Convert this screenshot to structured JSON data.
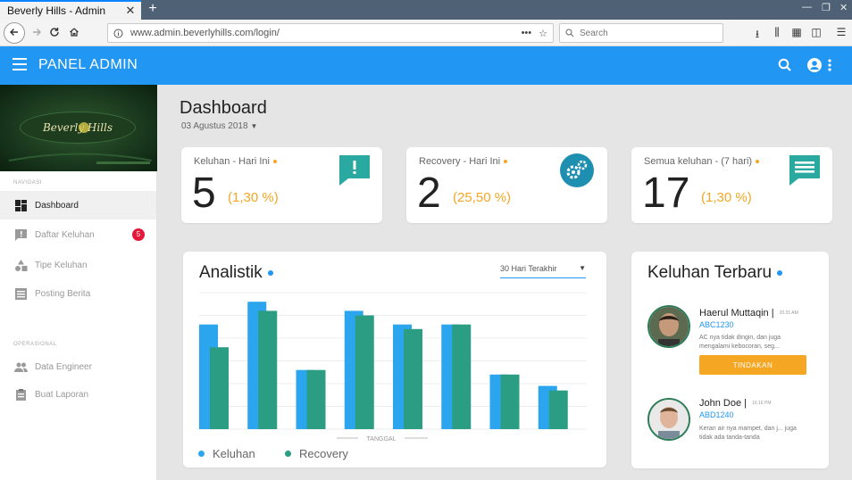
{
  "browser": {
    "tab_title": "Beverly Hills - Admin",
    "tab_close": "✕",
    "new_tab": "+",
    "url": "www.admin.beverlyhills.com/login/",
    "url_menu": "•••",
    "search_placeholder": "Search"
  },
  "app": {
    "title": "PANEL ADMIN",
    "accent": "#2196f3"
  },
  "sidebar": {
    "brand": "Beverly Hills",
    "sections": [
      {
        "label": "NAVIGASI",
        "items": [
          {
            "label": "Dashboard",
            "icon": "dashboard-icon",
            "active": true
          },
          {
            "label": "Daftar Keluhan",
            "icon": "feedback-icon",
            "badge": "5"
          },
          {
            "label": "Tipe Keluhan",
            "icon": "category-icon"
          },
          {
            "label": "Posting Berita",
            "icon": "news-icon"
          }
        ]
      },
      {
        "label": "OPERASIONAL",
        "items": [
          {
            "label": "Data Engineer",
            "icon": "people-icon"
          },
          {
            "label": "Buat Laporan",
            "icon": "report-icon"
          }
        ]
      }
    ]
  },
  "main": {
    "title": "Dashboard",
    "date": "03 Agustus 2018",
    "stats": [
      {
        "label": "Keluhan - Hari Ini",
        "value": "5",
        "pct": "(1,30 %)",
        "icon": "alert-message-icon"
      },
      {
        "label": "Recovery - Hari Ini",
        "value": "2",
        "pct": "(25,50 %)",
        "icon": "gears-icon"
      },
      {
        "label": "Semua keluhan - (7 hari)",
        "value": "17",
        "pct": "(1,30 %)",
        "icon": "chat-icon"
      }
    ],
    "analytics": {
      "title": "Analistik",
      "range": "30 Hari Terakhir"
    },
    "recent": {
      "title": "Keluhan Terbaru",
      "items": [
        {
          "name": "Haerul Muttaqin",
          "time": "20.31 AM",
          "code": "ABC1230",
          "desc": "AC nya tidak dingin, dan juga mengalami kebocoran, seg...",
          "action": "TINDAKAN"
        },
        {
          "name": "John Doe",
          "time": "16.16 PM",
          "code": "ABD1240",
          "desc": "Keran air nya mampet, dan j... juga tidak ada tanda-tanda"
        }
      ]
    }
  },
  "chart_data": {
    "type": "bar",
    "title": "Analistik",
    "xlabel": "TANGGAL",
    "ylabel": "",
    "ylim": [
      0,
      30
    ],
    "categories": [
      "",
      "",
      "",
      "",
      "",
      "",
      "",
      ""
    ],
    "series": [
      {
        "name": "Keluhan",
        "color": "#2ba6ee",
        "values": [
          23,
          28,
          13,
          26,
          23,
          23,
          12,
          9.5
        ]
      },
      {
        "name": "Recovery",
        "color": "#2a9d82",
        "values": [
          18,
          26,
          13,
          25,
          22,
          23,
          12,
          8.5
        ]
      }
    ]
  }
}
